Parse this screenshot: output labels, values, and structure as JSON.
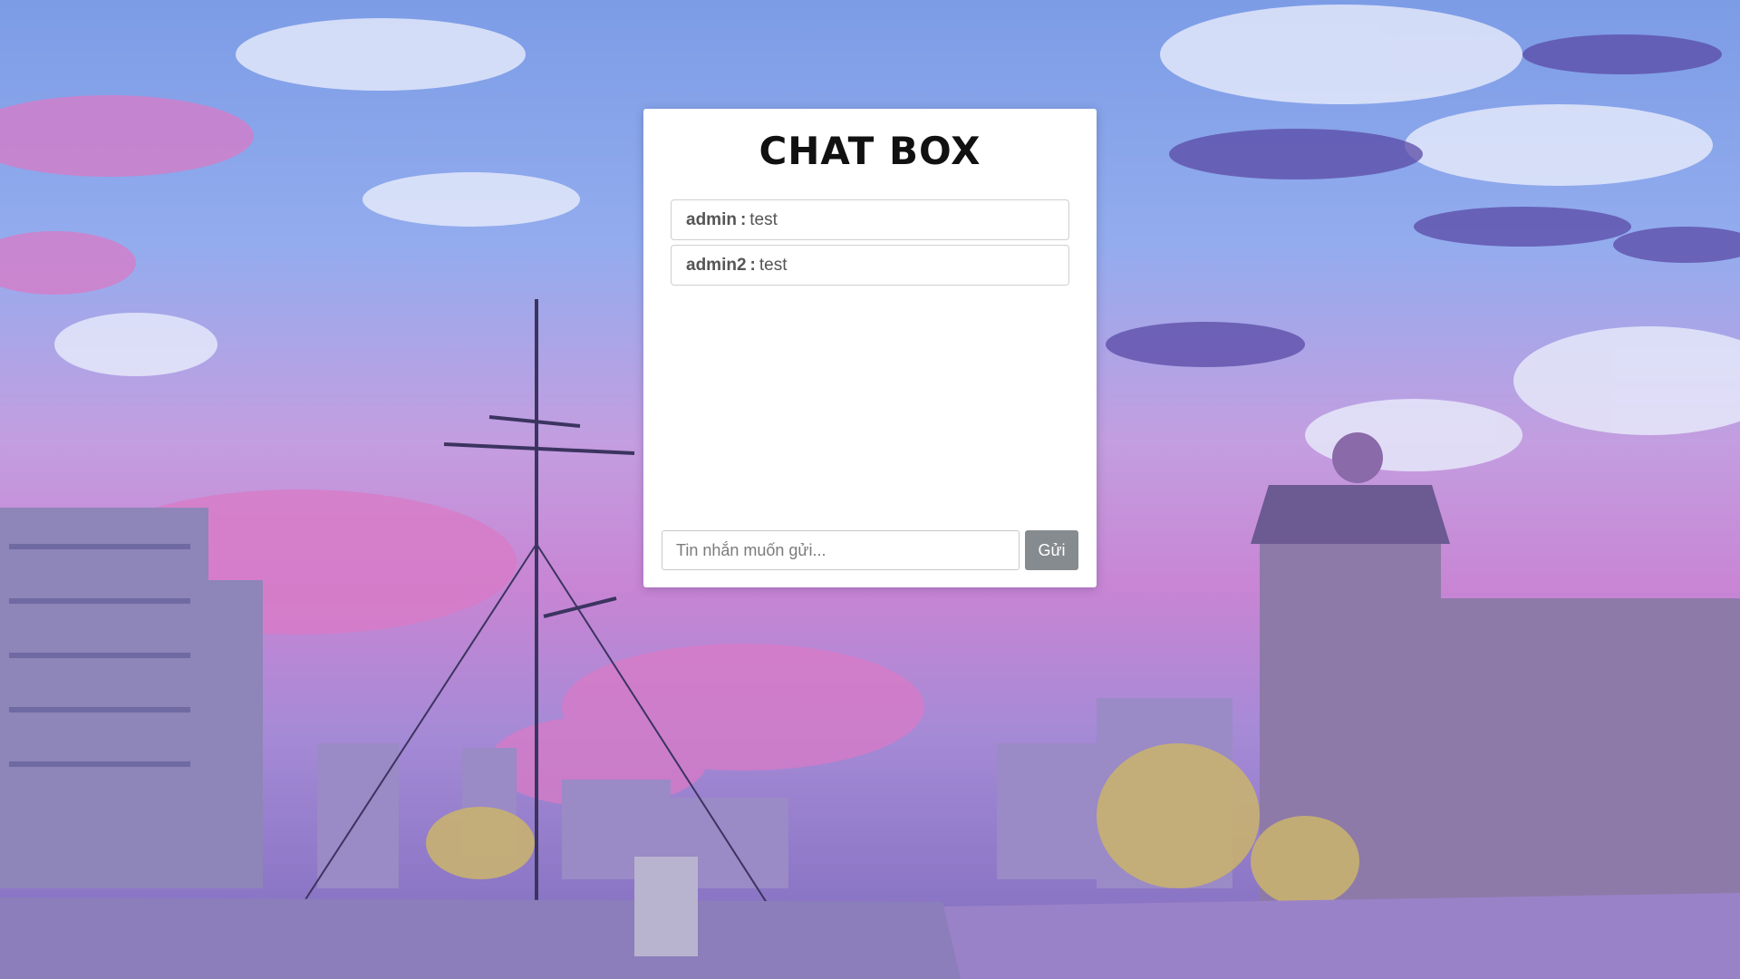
{
  "chat": {
    "title": "CHAT BOX",
    "messages": [
      {
        "user": "admin",
        "separator": ":",
        "text": "test"
      },
      {
        "user": "admin2",
        "separator": ":",
        "text": "test"
      }
    ],
    "input_placeholder": "Tin nhắn muốn gửi...",
    "input_value": "",
    "send_label": "Gửi"
  },
  "colors": {
    "send_button": "#868b8f",
    "panel": "#ffffff"
  }
}
